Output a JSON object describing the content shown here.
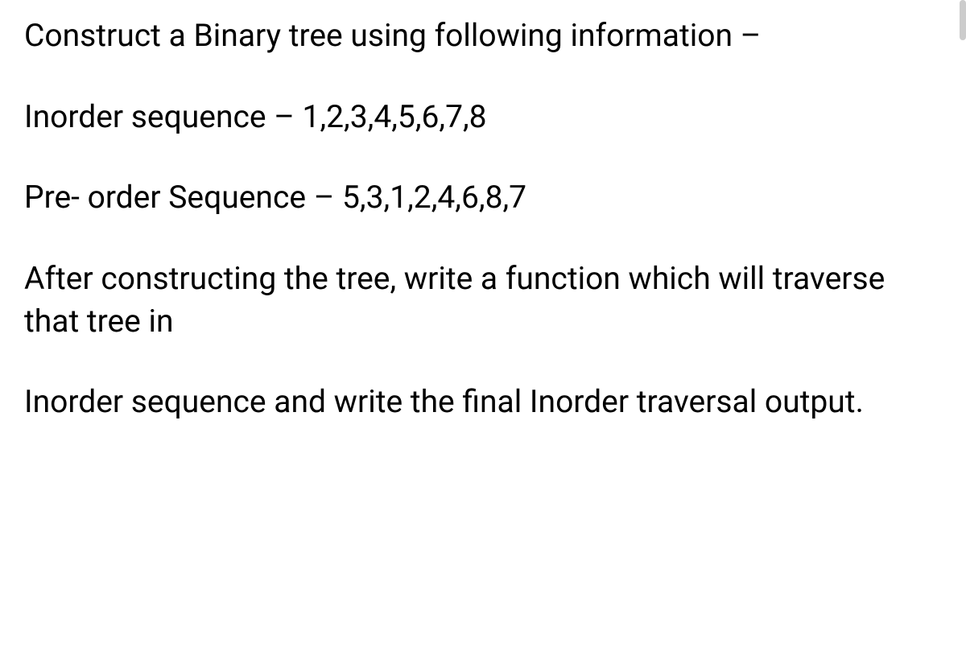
{
  "paragraphs": {
    "p1": "Construct a Binary tree using following information –",
    "p2": "Inorder sequence – 1,2,3,4,5,6,7,8",
    "p3": "Pre- order Sequence – 5,3,1,2,4,6,8,7",
    "p4": "After constructing the tree, write a function which will traverse that tree in",
    "p5": "Inorder sequence and write the final Inorder traversal output."
  }
}
